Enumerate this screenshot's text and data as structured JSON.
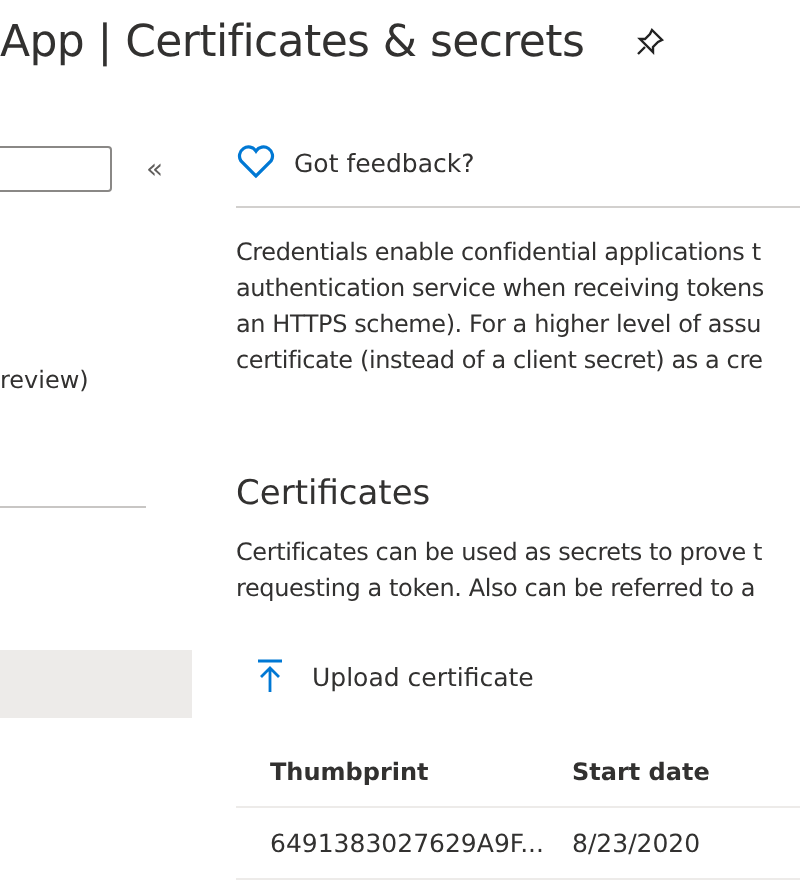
{
  "header": {
    "title_prefix": "App",
    "separator": "|",
    "title": "Certificates & secrets"
  },
  "sidebar": {
    "collapse": "«",
    "items": [
      {
        "label": "review)",
        "selected": false
      },
      {
        "selected": true
      }
    ]
  },
  "toolbar": {
    "feedback": "Got feedback?"
  },
  "intro": [
    "Credentials enable confidential applications t",
    "authentication service when receiving tokens",
    "an HTTPS scheme). For a higher level of assu",
    "certificate (instead of a client secret) as a cre"
  ],
  "certificates": {
    "heading": "Certificates",
    "description": [
      "Certificates can be used as secrets to prove t",
      "requesting a token. Also can be referred to a"
    ],
    "upload": "Upload certificate",
    "table": {
      "columns": [
        "Thumbprint",
        "Start date"
      ],
      "rows": [
        [
          "6491383027629A9F...",
          "8/23/2020"
        ]
      ]
    }
  }
}
